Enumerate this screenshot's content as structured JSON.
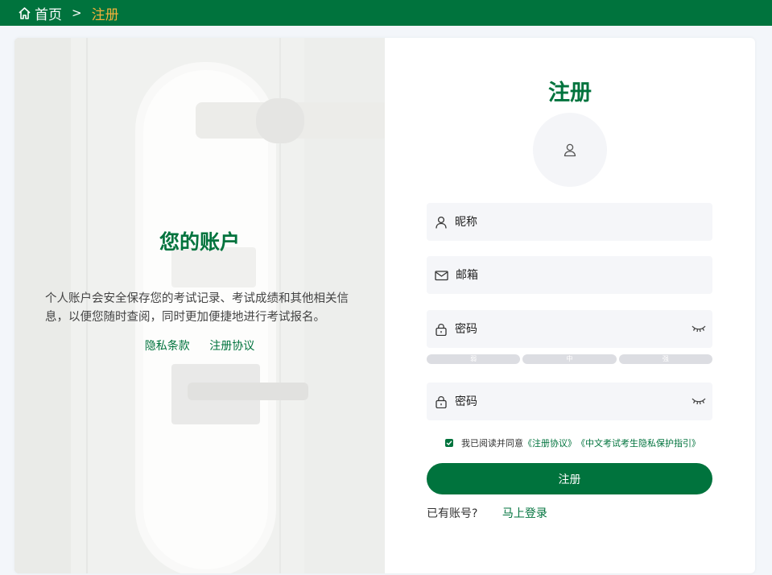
{
  "breadcrumb": {
    "home": "首页",
    "separator": ">",
    "current": "注册"
  },
  "left": {
    "title": "您的账户",
    "description": "个人账户会安全保存您的考试记录、考试成绩和其他相关信息，以便您随时查阅，同时更加便捷地进行考试报名。",
    "links": [
      "隐私条款",
      "注册协议"
    ]
  },
  "form": {
    "title": "注册",
    "nickname_placeholder": "昵称",
    "email_placeholder": "邮箱",
    "password_placeholder": "密码",
    "confirm_password_placeholder": "密码",
    "strength_levels": [
      "弱",
      "中",
      "强"
    ],
    "agree_prefix": "我已阅读并同意",
    "agreement_link": "《注册协议》",
    "privacy_link": "《中文考试考生隐私保护指引》",
    "submit_label": "注册",
    "has_account_text": "已有账号?",
    "login_link": "马上登录"
  },
  "colors": {
    "brand": "#00733d",
    "accent": "#f3b13b"
  }
}
